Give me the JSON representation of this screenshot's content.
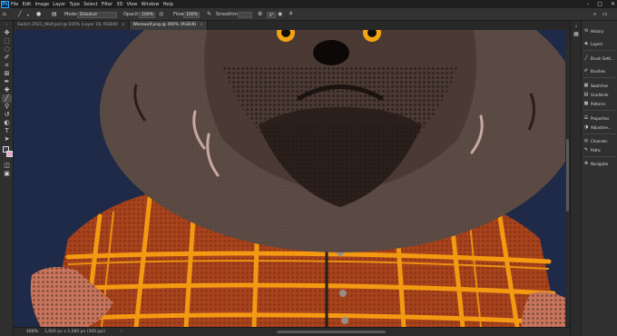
{
  "app": {
    "logo": "Ps"
  },
  "menu": [
    "File",
    "Edit",
    "Image",
    "Layer",
    "Type",
    "Select",
    "Filter",
    "3D",
    "View",
    "Window",
    "Help"
  ],
  "window_controls": [
    "–",
    "□",
    "✕"
  ],
  "options_bar": {
    "mode_label": "Mode:",
    "mode_value": "Dissolve",
    "opacity_label": "Opacity:",
    "opacity_value": "100%",
    "flow_label": "Flow:",
    "flow_value": "100%",
    "smoothing_label": "Smoothing:",
    "angle_value": "0°"
  },
  "tabs": [
    {
      "label": "Switch 2021_Wolf.psd @ 100% (Layer 16, RGB/8)",
      "close": "×",
      "active": false
    },
    {
      "label": "Werewolf.png @ 400% (RGB/8)",
      "close": "×",
      "active": true
    }
  ],
  "status_bar": {
    "zoom": "400%",
    "doc_info": "1,920 px x 1,080 px (300 ppi)",
    "arrow": "›"
  },
  "panels": [
    {
      "label": "History",
      "icon": "history-icon"
    },
    {
      "label": "Layers",
      "icon": "layers-icon"
    },
    {
      "label": "Brush Setti...",
      "icon": "brush-settings-icon"
    },
    {
      "label": "Brushes",
      "icon": "brushes-icon"
    },
    {
      "label": "Swatches",
      "icon": "swatches-icon"
    },
    {
      "label": "Gradients",
      "icon": "gradients-icon"
    },
    {
      "label": "Patterns",
      "icon": "patterns-icon"
    },
    {
      "label": "Properties",
      "icon": "properties-icon"
    },
    {
      "label": "Adjustme...",
      "icon": "adjustments-icon"
    },
    {
      "label": "Channels",
      "icon": "channels-icon"
    },
    {
      "label": "Paths",
      "icon": "paths-icon"
    },
    {
      "label": "Navigator",
      "icon": "navigator-icon"
    }
  ],
  "colors": {
    "foreground": "#3a3c4a",
    "background": "#e9a3d0",
    "canvas_bg": "#1e2a47",
    "fur": "#5b4b44",
    "muzzle": "#2b1f1b",
    "shirt": "#a8431c",
    "plaid": "#f39a12",
    "eyes": "#f4a413"
  }
}
